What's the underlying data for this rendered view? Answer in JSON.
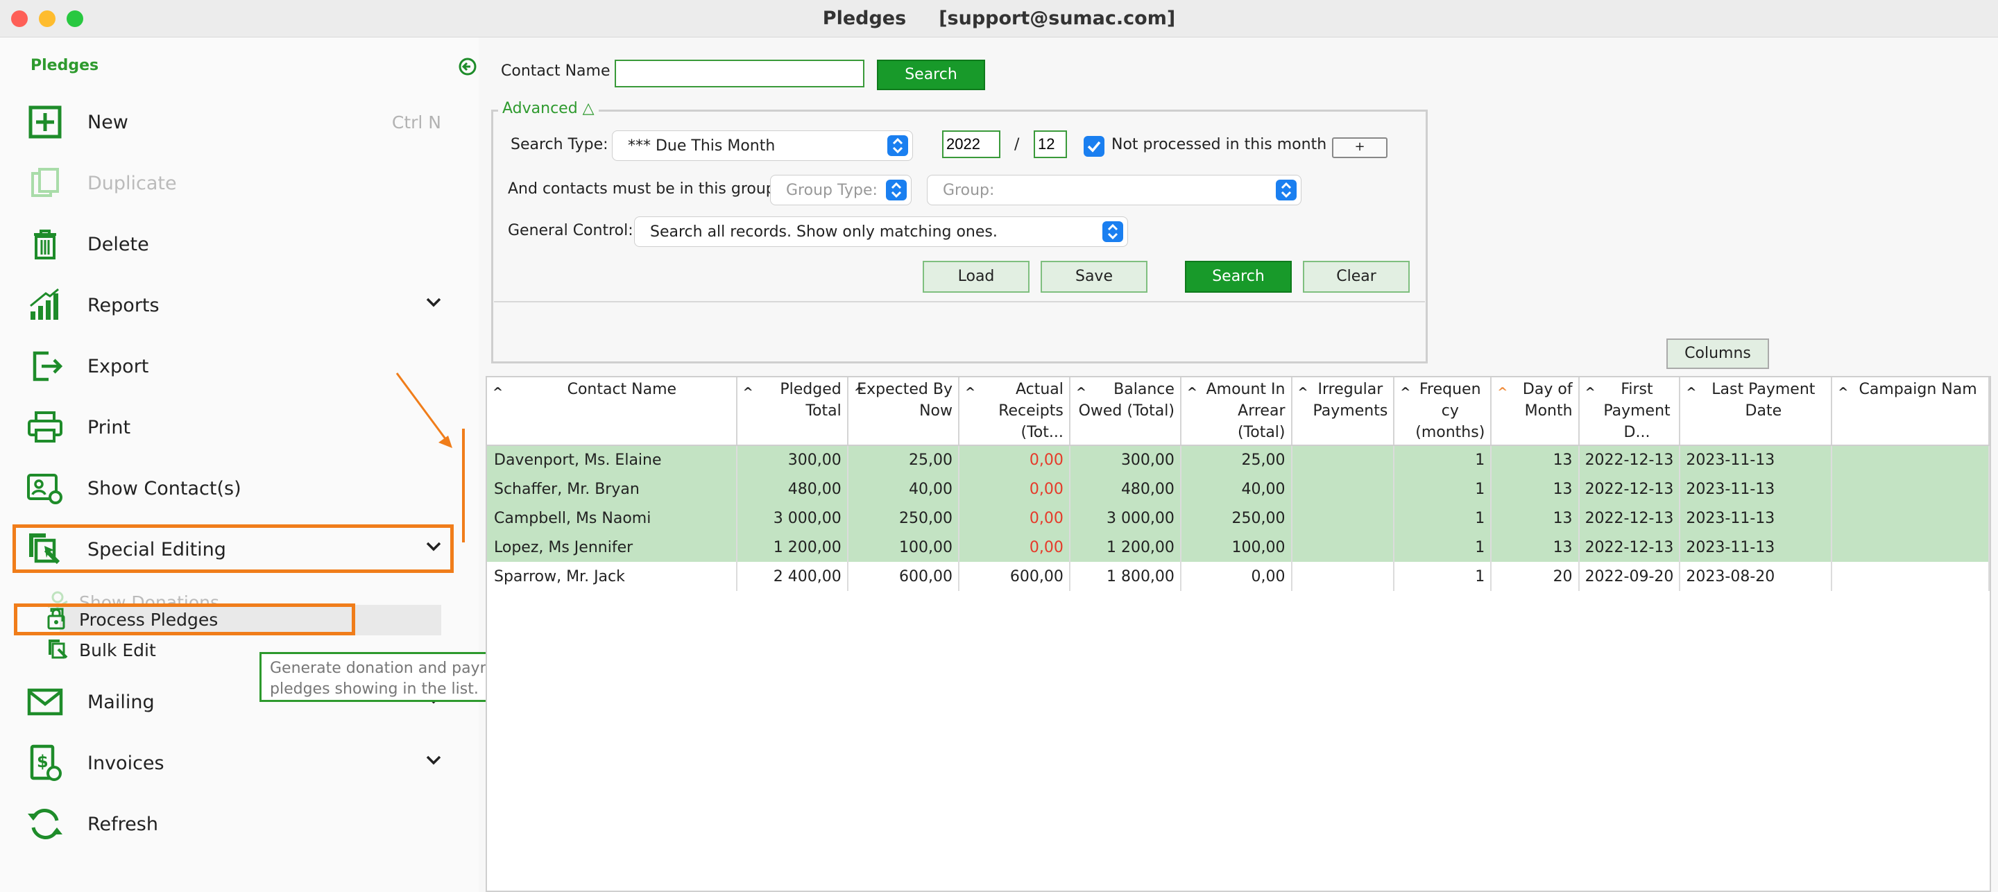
{
  "window": {
    "title": "Pledges     [support@sumac.com]"
  },
  "sidebar": {
    "header": "Pledges",
    "items": [
      {
        "label": "New",
        "shortcut": "Ctrl N"
      },
      {
        "label": "Duplicate"
      },
      {
        "label": "Delete"
      },
      {
        "label": "Reports"
      },
      {
        "label": "Export"
      },
      {
        "label": "Print"
      },
      {
        "label": "Show Contact(s)"
      },
      {
        "label": "Special Editing"
      },
      {
        "label": "Mailing"
      },
      {
        "label": "Invoices"
      },
      {
        "label": "Refresh"
      }
    ],
    "subitems": [
      {
        "label": "Show Donations"
      },
      {
        "label": "Process Pledges"
      },
      {
        "label": "Bulk Edit"
      }
    ],
    "tooltip": "Generate donation and payment records for the pledges showing in the list."
  },
  "search": {
    "contact_label": "Contact Name",
    "contact_value": "",
    "search_button": "Search",
    "advanced_label": "Advanced △",
    "search_type_label": "Search Type:",
    "search_type_value": "*** Due This Month",
    "year": "2022",
    "slash": "/",
    "month": "12",
    "not_processed_label": "Not processed in this month",
    "not_processed_checked": true,
    "plus_button": "+",
    "group_label": "And contacts must be in this group:",
    "group_type_placeholder": "Group Type:",
    "group_placeholder": "Group:",
    "general_control_label": "General Control:",
    "general_control_value": "Search all records. Show only matching ones.",
    "load_button": "Load",
    "save_button": "Save",
    "search_button2": "Search",
    "clear_button": "Clear"
  },
  "table": {
    "columns_button": "Columns",
    "headers": [
      "Contact Name",
      "Pledged Total",
      "Expected By Now",
      "Actual Receipts (Tot...",
      "Balance Owed (Total)",
      "Amount In Arrear (Total)",
      "Irregular Payments",
      "Frequen cy (months)",
      "Day of Month",
      "First Payment D...",
      "Last Payment Date",
      "Campaign Nam"
    ],
    "rows": [
      [
        "Davenport, Ms. Elaine",
        "300,00",
        "25,00",
        "0,00",
        "300,00",
        "25,00",
        "",
        "1",
        "13",
        "2022-12-13",
        "2023-11-13",
        ""
      ],
      [
        "Schaffer, Mr. Bryan",
        "480,00",
        "40,00",
        "0,00",
        "480,00",
        "40,00",
        "",
        "1",
        "13",
        "2022-12-13",
        "2023-11-13",
        ""
      ],
      [
        "Campbell, Ms Naomi",
        "3 000,00",
        "250,00",
        "0,00",
        "3 000,00",
        "250,00",
        "",
        "1",
        "13",
        "2022-12-13",
        "2023-11-13",
        ""
      ],
      [
        "Lopez, Ms Jennifer",
        "1 200,00",
        "100,00",
        "0,00",
        "1 200,00",
        "100,00",
        "",
        "1",
        "13",
        "2022-12-13",
        "2023-11-13",
        ""
      ],
      [
        "Sparrow, Mr. Jack",
        "2 400,00",
        "600,00",
        "600,00",
        "1 800,00",
        "0,00",
        "",
        "1",
        "20",
        "2022-09-20",
        "2023-08-20",
        ""
      ]
    ]
  },
  "colors": {
    "brand_green": "#189a2a",
    "highlight_orange": "#f07d1a",
    "selected_row": "#c3e3c3",
    "negative": "#e63a2a"
  }
}
